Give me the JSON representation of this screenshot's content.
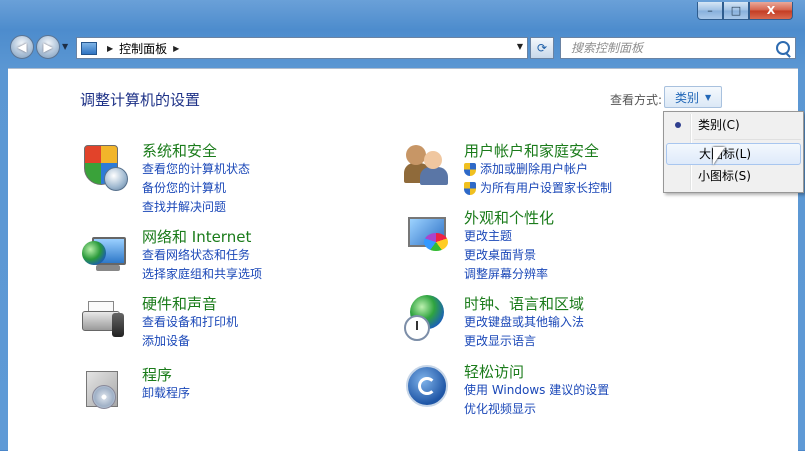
{
  "window": {
    "minimize": "–",
    "maximize": "□",
    "close": "X"
  },
  "nav": {
    "back": "◀",
    "forward": "▶",
    "recent": "▼",
    "breadcrumb": "控制面板",
    "sep": "▶",
    "refresh": "⟳",
    "search_placeholder": "搜索控制面板"
  },
  "header": {
    "title": "调整计算机的设置",
    "view_label": "查看方式:",
    "view_value": "类别"
  },
  "categories": [
    {
      "title": "系统和安全",
      "links": [
        "查看您的计算机状态",
        "备份您的计算机",
        "查找并解决问题"
      ]
    },
    {
      "title": "网络和 Internet",
      "links": [
        "查看网络状态和任务",
        "选择家庭组和共享选项"
      ]
    },
    {
      "title": "硬件和声音",
      "links": [
        "查看设备和打印机",
        "添加设备"
      ]
    },
    {
      "title": "程序",
      "links": [
        "卸载程序"
      ]
    },
    {
      "title": "用户帐户和家庭安全",
      "links": [
        "添加或删除用户帐户",
        "为所有用户设置家长控制"
      ]
    },
    {
      "title": "外观和个性化",
      "links": [
        "更改主题",
        "更改桌面背景",
        "调整屏幕分辨率"
      ]
    },
    {
      "title": "时钟、语言和区域",
      "links": [
        "更改键盘或其他输入法",
        "更改显示语言"
      ]
    },
    {
      "title": "轻松访问",
      "links": [
        "使用 Windows 建议的设置",
        "优化视频显示"
      ]
    }
  ],
  "view_menu": {
    "items": [
      "类别(C)",
      "大图标(L)",
      "小图标(S)"
    ],
    "selected": 0,
    "hovered": 1
  }
}
